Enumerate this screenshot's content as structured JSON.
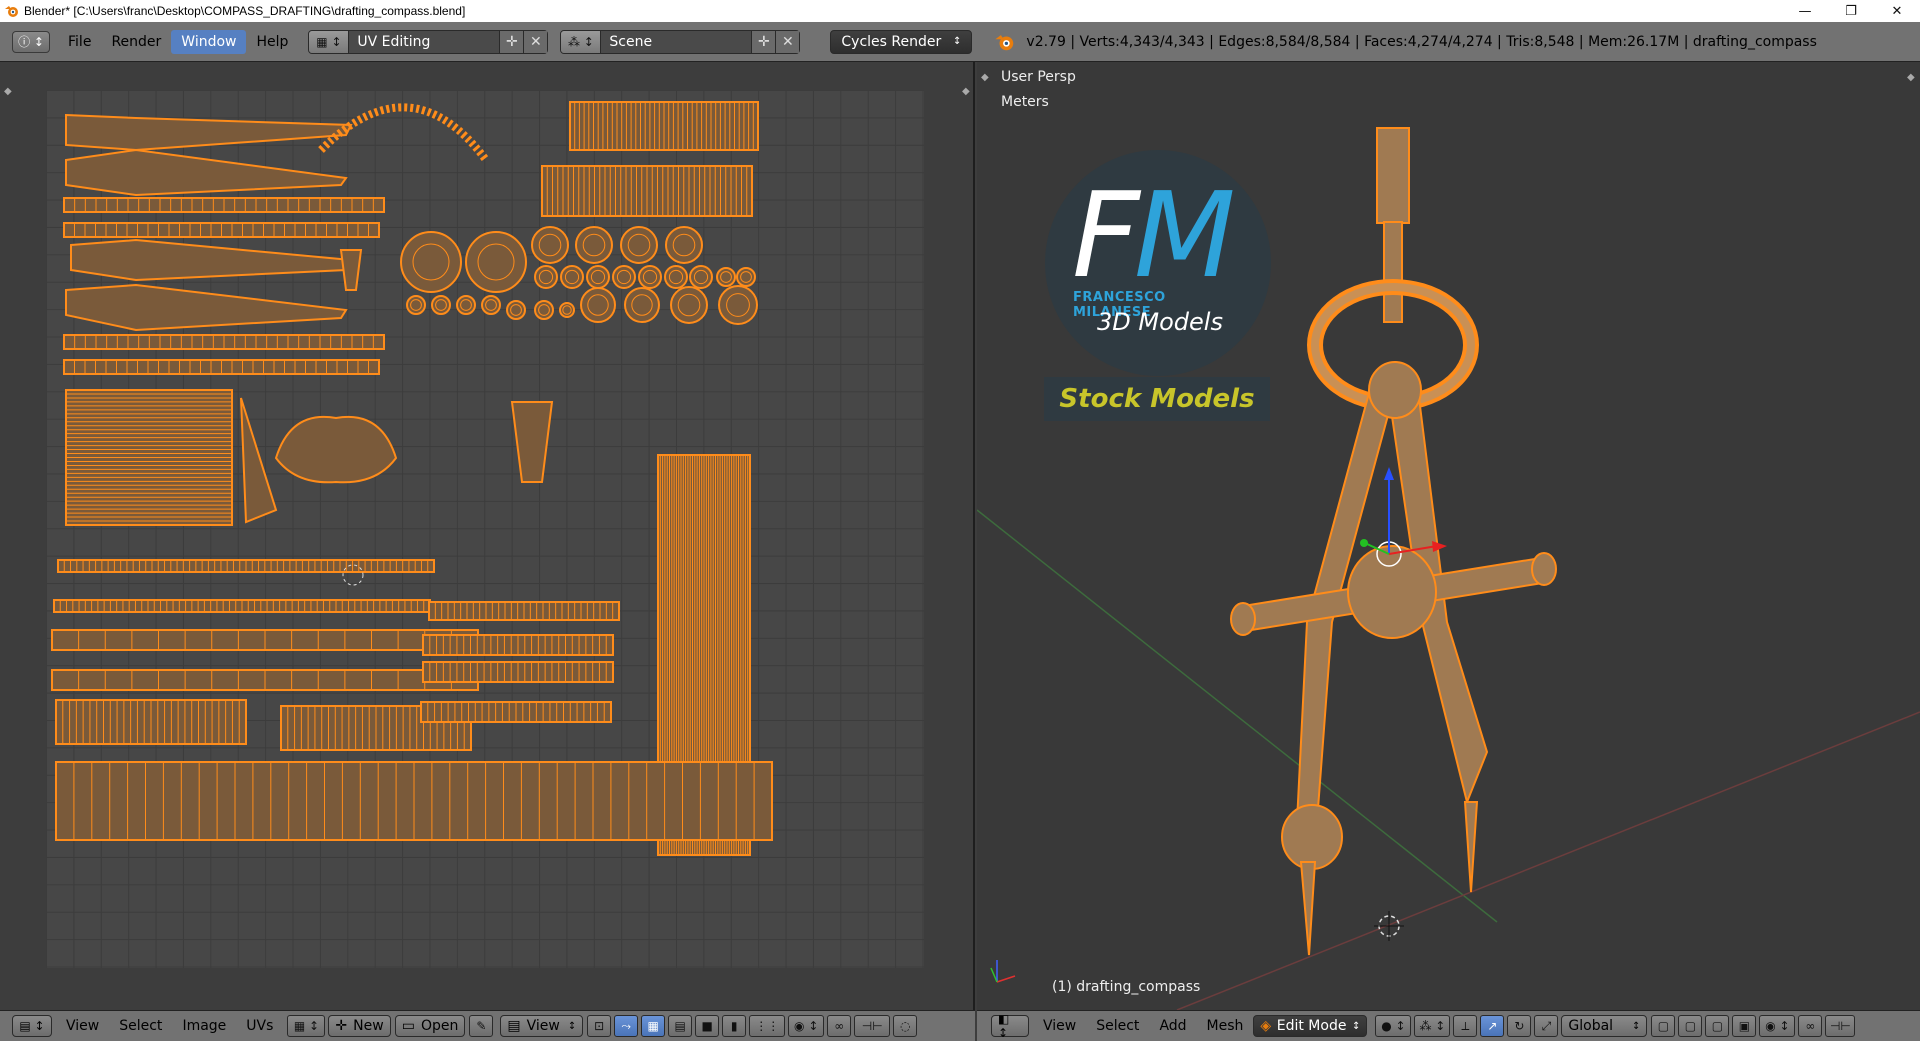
{
  "window": {
    "title": "Blender* [C:\\Users\\franc\\Desktop\\COMPASS_DRAFTING\\drafting_compass.blend]",
    "minimize": "—",
    "maximize": "❐",
    "close": "✕"
  },
  "info_header": {
    "menus": [
      "File",
      "Render",
      "Window",
      "Help"
    ],
    "active_menu": "Window",
    "screen_layout": "UV Editing",
    "scene": "Scene",
    "render_engine": "Cycles Render",
    "stats": "v2.79 | Verts:4,343/4,343 | Edges:8,584/8,584 | Faces:4,274/4,274 | Tris:8,548 | Mem:26.17M | drafting_compass"
  },
  "uv_editor": {
    "menus": [
      "View",
      "Select",
      "Image",
      "UVs"
    ],
    "new_label": "New",
    "open_label": "Open",
    "view_label": "View"
  },
  "view3d": {
    "view_label": "User Persp",
    "units_label": "Meters",
    "object_label": "(1) drafting_compass",
    "menus": [
      "View",
      "Select",
      "Add",
      "Mesh"
    ],
    "mode": "Edit Mode",
    "orientation": "Global"
  },
  "watermark": {
    "letters_f": "F",
    "letters_m": "M",
    "company": "FRANCESCO MILANESE",
    "tagline": "3D Models",
    "banner": "Stock Models"
  },
  "colors": {
    "uv_wire": "#ff8c1a",
    "accent_blue": "#5680c2",
    "logo_blue": "#2ea3da",
    "stock_yellow": "#c8c52a"
  }
}
